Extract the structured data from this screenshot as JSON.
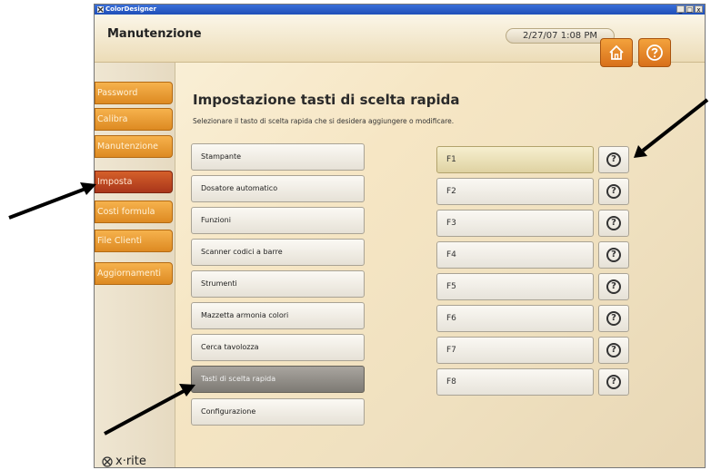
{
  "window": {
    "app_name": "ColorDesigner",
    "min_glyph": "_",
    "max_glyph": "□",
    "close_glyph": "x"
  },
  "header": {
    "title": "Manutenzione",
    "datetime": "2/27/07 1:08 PM",
    "home_icon": "home-icon",
    "help_icon": "help-icon"
  },
  "sidebar": {
    "items": [
      {
        "label": "Password",
        "active": false
      },
      {
        "label": "Calibra",
        "active": false
      },
      {
        "label": "Manutenzione",
        "active": false
      },
      {
        "label": "Imposta",
        "active": true
      },
      {
        "label": "Costi formula",
        "active": false
      },
      {
        "label": "File Clienti",
        "active": false
      },
      {
        "label": "Aggiornamenti",
        "active": false
      }
    ],
    "brand": "x·rite"
  },
  "main": {
    "title": "Impostazione tasti di scelta rapida",
    "subtitle": "Selezionare il tasto di scelta rapida che si desidera aggiungere o modificare.",
    "options": [
      {
        "label": "Stampante",
        "selected": false
      },
      {
        "label": "Dosatore automatico",
        "selected": false
      },
      {
        "label": "Funzioni",
        "selected": false
      },
      {
        "label": "Scanner codici a barre",
        "selected": false
      },
      {
        "label": "Strumenti",
        "selected": false
      },
      {
        "label": "Mazzetta armonia colori",
        "selected": false
      },
      {
        "label": "Cerca tavolozza",
        "selected": false
      },
      {
        "label": "Tasti di scelta rapida",
        "selected": true
      },
      {
        "label": "Configurazione",
        "selected": false
      }
    ],
    "fkeys": [
      {
        "label": "F1",
        "selected": true
      },
      {
        "label": "F2",
        "selected": false
      },
      {
        "label": "F3",
        "selected": false
      },
      {
        "label": "F4",
        "selected": false
      },
      {
        "label": "F5",
        "selected": false
      },
      {
        "label": "F6",
        "selected": false
      },
      {
        "label": "F7",
        "selected": false
      },
      {
        "label": "F8",
        "selected": false
      }
    ],
    "help_glyph": "?"
  },
  "colors": {
    "sidebar_orange": "#dd8a22",
    "sidebar_active": "#a9361b",
    "selected_option": "#7d7a74",
    "selected_fkey": "#dfd2a2"
  }
}
